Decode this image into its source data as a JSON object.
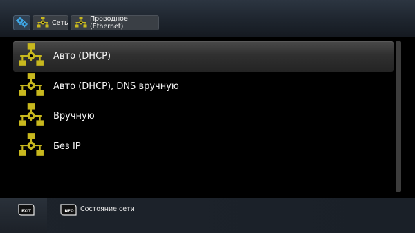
{
  "breadcrumbs": [
    {
      "label": "",
      "icon": "settings-gears-icon"
    },
    {
      "label": "Сеть",
      "icon": "network-icon"
    },
    {
      "label": "Проводное (Ethernet)",
      "icon": "network-icon"
    }
  ],
  "menu": {
    "items": [
      {
        "label": "Авто (DHCP)",
        "icon": "network-icon",
        "selected": true
      },
      {
        "label": "Авто (DHCP), DNS вручную",
        "icon": "network-icon",
        "selected": false
      },
      {
        "label": "Вручную",
        "icon": "network-icon",
        "selected": false
      },
      {
        "label": "Без IP",
        "icon": "network-icon",
        "selected": false
      }
    ]
  },
  "footer": {
    "exit_key": "EXIT",
    "info_key": "INFO",
    "info_label": "Состояние сети"
  },
  "colors": {
    "icon_yellow": "#c8b81e",
    "selection": "#3a3a3a",
    "background": "#000000"
  }
}
